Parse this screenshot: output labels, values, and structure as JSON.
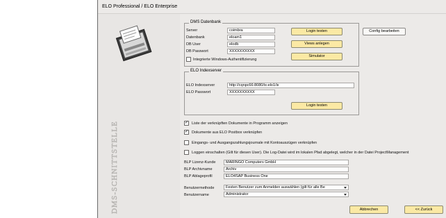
{
  "window": {
    "title": "ELO Professional / ELO Enterprise"
  },
  "side": {
    "vertical_text": "DMS-SCHNITTSTELLE"
  },
  "dms": {
    "title": "DMS Datenbank",
    "server_label": "Server",
    "server_value": "coimbra",
    "db_label": "Datenbank",
    "db_value": "eloam1",
    "user_label": "DB User",
    "user_value": "elodb",
    "pass_label": "DB Passwort",
    "pass_value": "XXXXXXXXXX",
    "win_auth_label": "Integrierte Windows-Authentifizierung",
    "win_auth_checked": false,
    "btn_login": "Login testen",
    "btn_views": "Views anlegen",
    "btn_simulator": "Simulator",
    "btn_config": "Config bearbeiten"
  },
  "index": {
    "title": "ELO Indexserver",
    "url_label": "ELO Indexserver",
    "url_value": "http://cqnpc66:8080/ix-elo1/ix",
    "pass_label": "ELO Passwort",
    "pass_value": "XXXXXXXXXX",
    "btn_login": "Login testen"
  },
  "options": [
    {
      "label": "Liste der verknüpften Dokumente in Programm anzeigen",
      "checked": true
    },
    {
      "label": "Dokumente aus ELO Postbox verknüpfen",
      "checked": true
    },
    {
      "label": "Eingangs- und Ausgangszahlungsjournale mit Kontoauszügen verknüpfen",
      "checked": false
    },
    {
      "label": "Loggen einschalten (Gilt für diesen User). Die Log-Datei wird im lokalen Pfad abgelegt, welcher in der Datei ProjectManagement",
      "checked": false
    }
  ],
  "license": {
    "kunde_label": "BLP Lizenz-Kunde",
    "kunde_value": "MARINGO Computers GmbH",
    "archiv_label": "BLP Archivname",
    "archiv_value": "Archiv",
    "ablage_label": "BLP Ablageprofil",
    "ablage_value": "ELO4SAP Business One"
  },
  "user": {
    "method_label": "Benutzermethode",
    "method_value": "Festen Benutzer zum Anmelden auswählen (gilt für alle Be",
    "name_label": "Benutzername",
    "name_value": "Administrator"
  },
  "footer": {
    "cancel": "Abbrechen",
    "back": "<< Zurück"
  },
  "colors": {
    "yellow_button": "#fbe9a4",
    "window_bg": "#eceae8"
  }
}
